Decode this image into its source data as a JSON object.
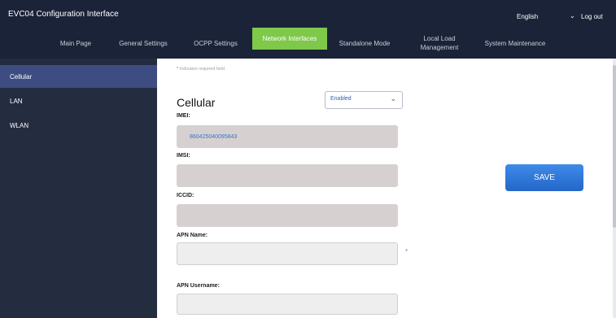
{
  "header": {
    "title": "EVC04 Configuration Interface",
    "language": "English",
    "logout_label": "Log out"
  },
  "nav": {
    "items": [
      {
        "label": "Main Page"
      },
      {
        "label": "General Settings"
      },
      {
        "label": "OCPP Settings"
      },
      {
        "label": "Network Interfaces"
      },
      {
        "label": "Standalone Mode"
      },
      {
        "label": "Local Load Management"
      },
      {
        "label": "System Maintenance"
      }
    ],
    "active": "Network Interfaces"
  },
  "sidebar": {
    "items": [
      {
        "label": "Cellular"
      },
      {
        "label": "LAN"
      },
      {
        "label": "WLAN"
      }
    ],
    "active": "Cellular"
  },
  "form": {
    "required_note": "Indicates required field",
    "required_marker": "*",
    "title": "Cellular",
    "status": {
      "selected": "Enabled"
    },
    "fields": [
      {
        "label": "IMEI:",
        "value": "860425040095843"
      },
      {
        "label": "IMSI:",
        "value": ""
      },
      {
        "label": "ICCID:",
        "value": ""
      },
      {
        "label": "APN Name:",
        "value": ""
      },
      {
        "label": "APN Username:",
        "value": ""
      }
    ],
    "save_label": "SAVE"
  },
  "colors": {
    "topbar": "#1b2338",
    "sidebar": "#242c40",
    "sidebar_active": "#3d4d82",
    "nav_active": "#7ec84a",
    "save_button": "#2f76d8"
  }
}
